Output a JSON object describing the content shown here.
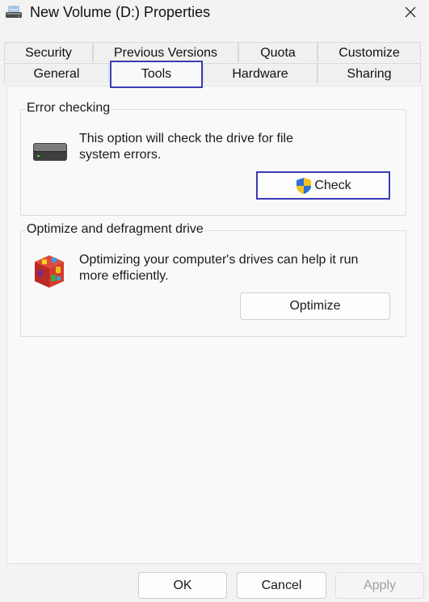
{
  "window": {
    "title": "New Volume (D:) Properties",
    "icon": "drive-icon",
    "close_icon": "close-icon"
  },
  "tabs": {
    "row1": [
      "Security",
      "Previous Versions",
      "Quota",
      "Customize"
    ],
    "row2": [
      "General",
      "Tools",
      "Hardware",
      "Sharing"
    ],
    "selected": "Tools"
  },
  "error_checking": {
    "title": "Error checking",
    "description_line1": "This option will check the drive for file",
    "description_line2": "system errors.",
    "button_label": "Check",
    "icon": "hard-drive-icon",
    "button_icon": "uac-shield-icon"
  },
  "optimize": {
    "title": "Optimize and defragment drive",
    "description_line1": "Optimizing your computer's drives can help it run",
    "description_line2": "more efficiently.",
    "button_label": "Optimize",
    "icon": "defrag-icon"
  },
  "footer": {
    "ok_label": "OK",
    "cancel_label": "Cancel",
    "apply_label": "Apply"
  },
  "colors": {
    "focus_border": "#3b3bb5",
    "background": "#f3f3f3"
  }
}
